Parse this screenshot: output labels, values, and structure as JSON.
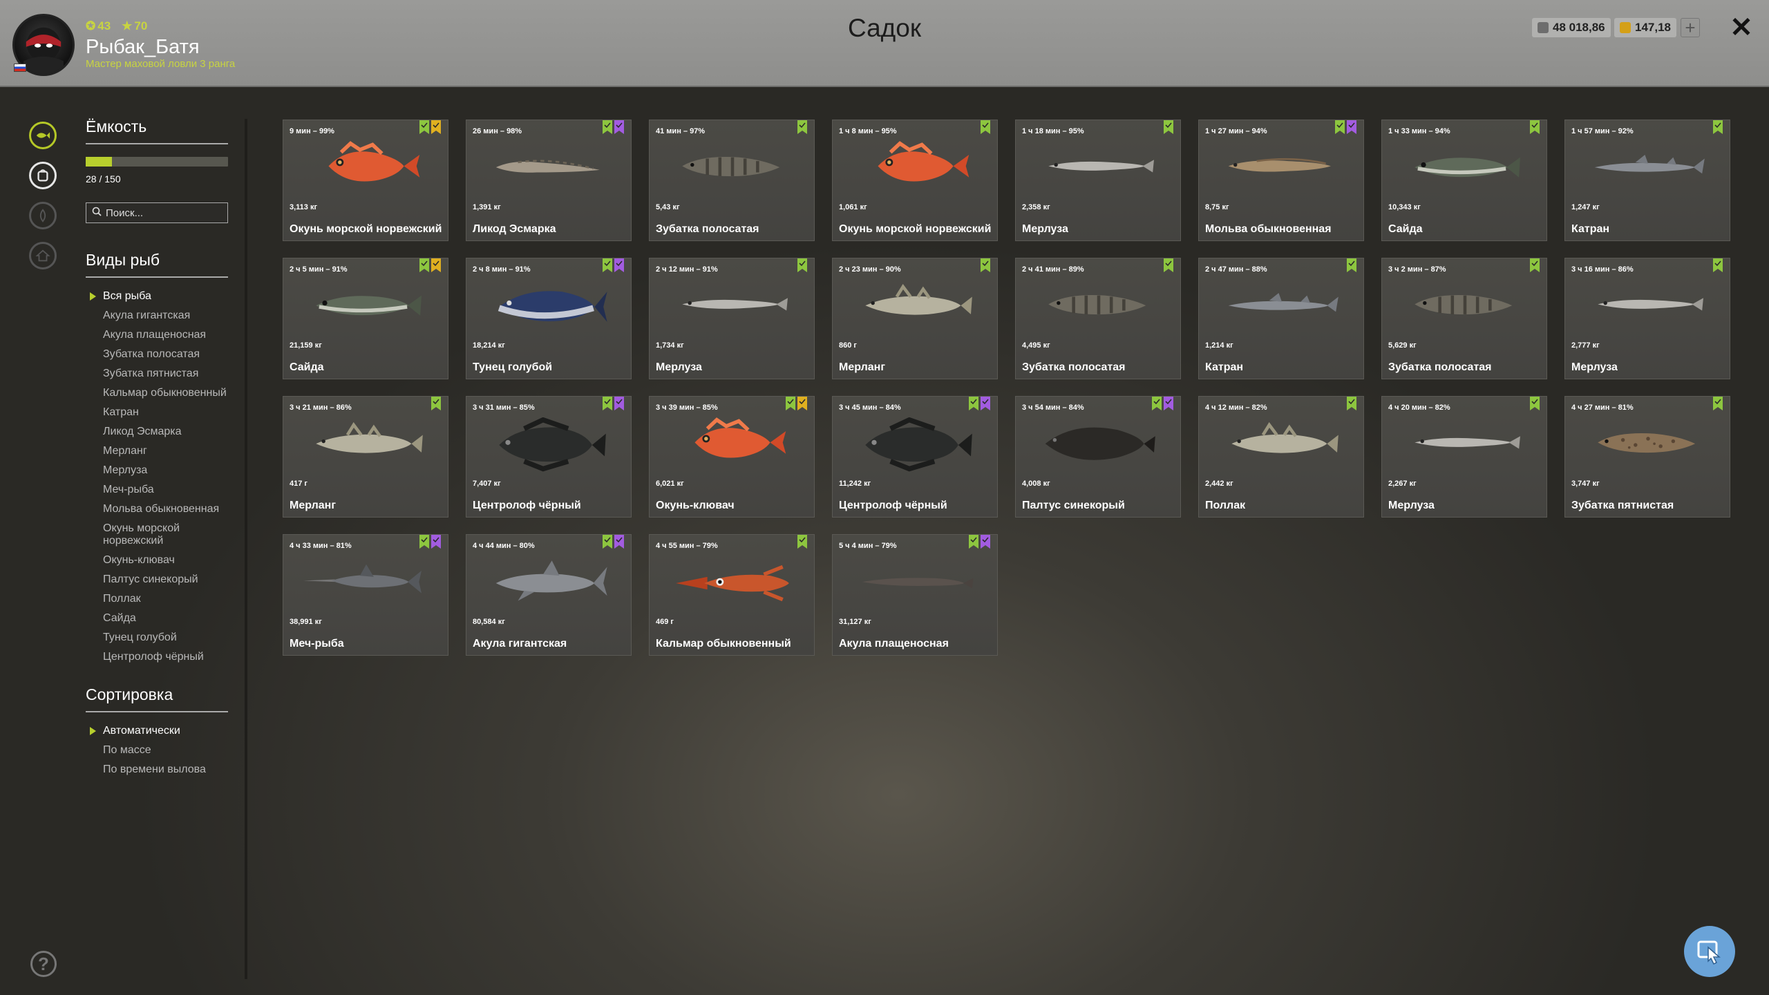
{
  "header": {
    "title": "Садок",
    "player": {
      "level": "43",
      "stars": "70",
      "name": "Рыбак_Батя",
      "rank_title": "Мастер маховой ловли 3 ранга"
    },
    "silver": "48 018,86",
    "gold": "147,18",
    "add_label": "+",
    "close_label": "✕"
  },
  "sidebar": {
    "capacity_title": "Ёмкость",
    "capacity_text": "28 / 150",
    "capacity_fraction": 0.1867,
    "search_placeholder": "Поиск...",
    "species_title": "Виды рыб",
    "species": [
      "Вся рыба",
      "Акула гигантская",
      "Акула плащеносная",
      "Зубатка полосатая",
      "Зубатка пятнистая",
      "Кальмар обыкновенный",
      "Катран",
      "Ликод Эсмарка",
      "Мерланг",
      "Мерлуза",
      "Меч-рыба",
      "Мольва обыкновенная",
      "Окунь морской норвежский",
      "Окунь-клювач",
      "Палтус синекорый",
      "Поллак",
      "Сайда",
      "Тунец голубой",
      "Центролоф чёрный"
    ],
    "sort_title": "Сортировка",
    "sort_options": [
      "Автоматически",
      "По массе",
      "По времени вылова"
    ],
    "help_label": "?"
  },
  "colors": {
    "accent_green": "#b8cf2d",
    "badge_green": "#8dc63f",
    "badge_purple": "#a25ce0",
    "badge_gold": "#e0b020"
  },
  "fish": [
    {
      "time": "9 мин – 99%",
      "weight": "3,113 кг",
      "name": "Окунь морской норвежский",
      "badges": [
        "green",
        "gold"
      ],
      "kind": "redfish"
    },
    {
      "time": "26 мин – 98%",
      "weight": "1,391 кг",
      "name": "Ликод Эсмарка",
      "badges": [
        "green",
        "purple"
      ],
      "kind": "eelpout"
    },
    {
      "time": "41 мин – 97%",
      "weight": "5,43 кг",
      "name": "Зубатка полосатая",
      "badges": [
        "green"
      ],
      "kind": "wolffish"
    },
    {
      "time": "1 ч 8 мин – 95%",
      "weight": "1,061 кг",
      "name": "Окунь морской норвежский",
      "badges": [
        "green"
      ],
      "kind": "redfish"
    },
    {
      "time": "1 ч 18 мин – 95%",
      "weight": "2,358 кг",
      "name": "Мерлуза",
      "badges": [
        "green"
      ],
      "kind": "hake"
    },
    {
      "time": "1 ч 27 мин – 94%",
      "weight": "8,75 кг",
      "name": "Мольва обыкновенная",
      "badges": [
        "green",
        "purple"
      ],
      "kind": "ling"
    },
    {
      "time": "1 ч 33 мин – 94%",
      "weight": "10,343 кг",
      "name": "Сайда",
      "badges": [
        "green"
      ],
      "kind": "saithe"
    },
    {
      "time": "1 ч 57 мин – 92%",
      "weight": "1,247 кг",
      "name": "Катран",
      "badges": [
        "green"
      ],
      "kind": "dogfish"
    },
    {
      "time": "2 ч 5 мин – 91%",
      "weight": "21,159 кг",
      "name": "Сайда",
      "badges": [
        "green",
        "gold"
      ],
      "kind": "saithe"
    },
    {
      "time": "2 ч 8 мин – 91%",
      "weight": "18,214 кг",
      "name": "Тунец голубой",
      "badges": [
        "green",
        "purple"
      ],
      "kind": "tuna"
    },
    {
      "time": "2 ч 12 мин – 91%",
      "weight": "1,734 кг",
      "name": "Мерлуза",
      "badges": [
        "green"
      ],
      "kind": "hake"
    },
    {
      "time": "2 ч 23 мин – 90%",
      "weight": "860 г",
      "name": "Мерланг",
      "badges": [
        "green"
      ],
      "kind": "whiting"
    },
    {
      "time": "2 ч 41 мин – 89%",
      "weight": "4,495 кг",
      "name": "Зубатка полосатая",
      "badges": [
        "green"
      ],
      "kind": "wolffish"
    },
    {
      "time": "2 ч 47 мин – 88%",
      "weight": "1,214 кг",
      "name": "Катран",
      "badges": [
        "green"
      ],
      "kind": "dogfish"
    },
    {
      "time": "3 ч 2 мин – 87%",
      "weight": "5,629 кг",
      "name": "Зубатка полосатая",
      "badges": [
        "green"
      ],
      "kind": "wolffish"
    },
    {
      "time": "3 ч 16 мин – 86%",
      "weight": "2,777 кг",
      "name": "Мерлуза",
      "badges": [
        "green"
      ],
      "kind": "hake"
    },
    {
      "time": "3 ч 21 мин – 86%",
      "weight": "417 г",
      "name": "Мерланг",
      "badges": [
        "green"
      ],
      "kind": "whiting"
    },
    {
      "time": "3 ч 31 мин – 85%",
      "weight": "7,407 кг",
      "name": "Центролоф чёрный",
      "badges": [
        "green",
        "purple"
      ],
      "kind": "blackfish"
    },
    {
      "time": "3 ч 39 мин – 85%",
      "weight": "6,021 кг",
      "name": "Окунь-клювач",
      "badges": [
        "green",
        "gold"
      ],
      "kind": "redfish"
    },
    {
      "time": "3 ч 45 мин – 84%",
      "weight": "11,242 кг",
      "name": "Центролоф чёрный",
      "badges": [
        "green",
        "purple"
      ],
      "kind": "blackfish"
    },
    {
      "time": "3 ч 54 мин – 84%",
      "weight": "4,008 кг",
      "name": "Палтус синекорый",
      "badges": [
        "green",
        "purple"
      ],
      "kind": "halibut"
    },
    {
      "time": "4 ч 12 мин – 82%",
      "weight": "2,442 кг",
      "name": "Поллак",
      "badges": [
        "green"
      ],
      "kind": "whiting"
    },
    {
      "time": "4 ч 20 мин – 82%",
      "weight": "2,267 кг",
      "name": "Мерлуза",
      "badges": [
        "green"
      ],
      "kind": "hake"
    },
    {
      "time": "4 ч 27 мин – 81%",
      "weight": "3,747 кг",
      "name": "Зубатка пятнистая",
      "badges": [
        "green"
      ],
      "kind": "spottedwolf"
    },
    {
      "time": "4 ч 33 мин – 81%",
      "weight": "38,991 кг",
      "name": "Меч-рыба",
      "badges": [
        "green",
        "purple"
      ],
      "kind": "swordfish"
    },
    {
      "time": "4 ч 44 мин – 80%",
      "weight": "80,584 кг",
      "name": "Акула гигантская",
      "badges": [
        "green",
        "purple"
      ],
      "kind": "shark"
    },
    {
      "time": "4 ч 55 мин – 79%",
      "weight": "469 г",
      "name": "Кальмар обыкновенный",
      "badges": [
        "green"
      ],
      "kind": "squid"
    },
    {
      "time": "5 ч 4 мин – 79%",
      "weight": "31,127 кг",
      "name": "Акула плащеносная",
      "badges": [
        "green",
        "purple"
      ],
      "kind": "frilled"
    }
  ]
}
